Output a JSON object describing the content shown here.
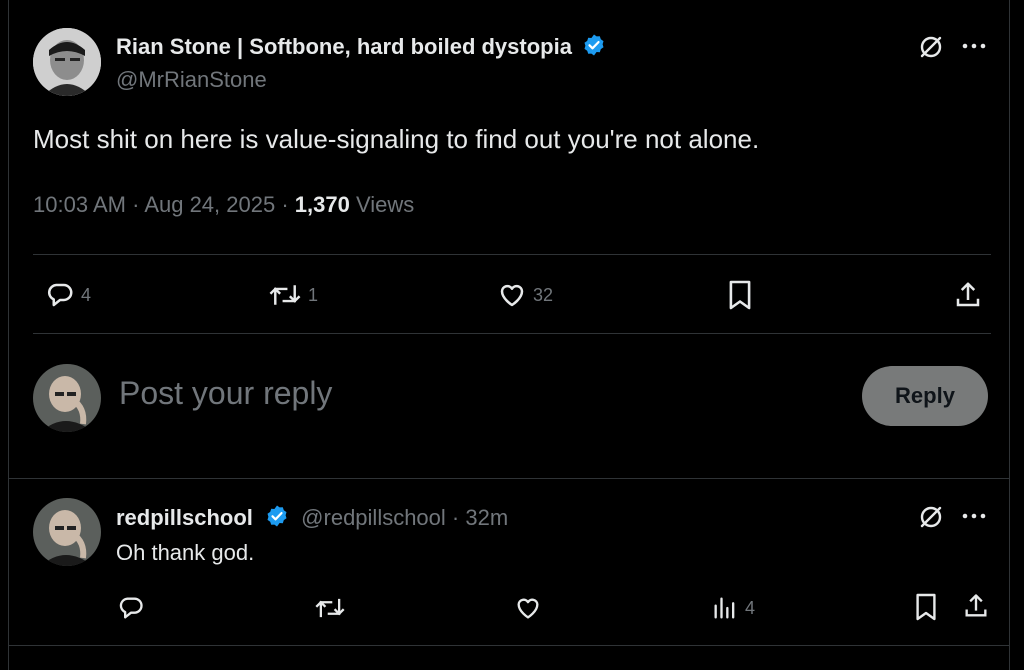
{
  "tweet": {
    "author_name": "Rian Stone | Softbone, hard boiled dystopia",
    "handle": "@MrRianStone",
    "text": "Most shit on here is value-signaling to find out you're not alone.",
    "time": "10:03 AM",
    "separator": "·",
    "date": "Aug 24, 2025",
    "views_count": "1,370",
    "views_label": "Views",
    "actions": {
      "replies": "4",
      "reposts": "1",
      "likes": "32"
    }
  },
  "composer": {
    "placeholder": "Post your reply",
    "button_label": "Reply"
  },
  "reply": {
    "author_name": "redpillschool",
    "handle": "@redpillschool",
    "age": "· 32m",
    "text": "Oh thank god.",
    "actions": {
      "views": "4"
    }
  },
  "colors": {
    "background": "#000000",
    "text": "#e7e9ea",
    "muted": "#71767b",
    "verified": "#1d9bf0",
    "divider": "#2f3336"
  },
  "icons": [
    "grok-icon",
    "more-icon",
    "reply-icon",
    "repost-icon",
    "like-icon",
    "bookmark-icon",
    "share-icon",
    "views-icon",
    "verified-badge-icon"
  ]
}
